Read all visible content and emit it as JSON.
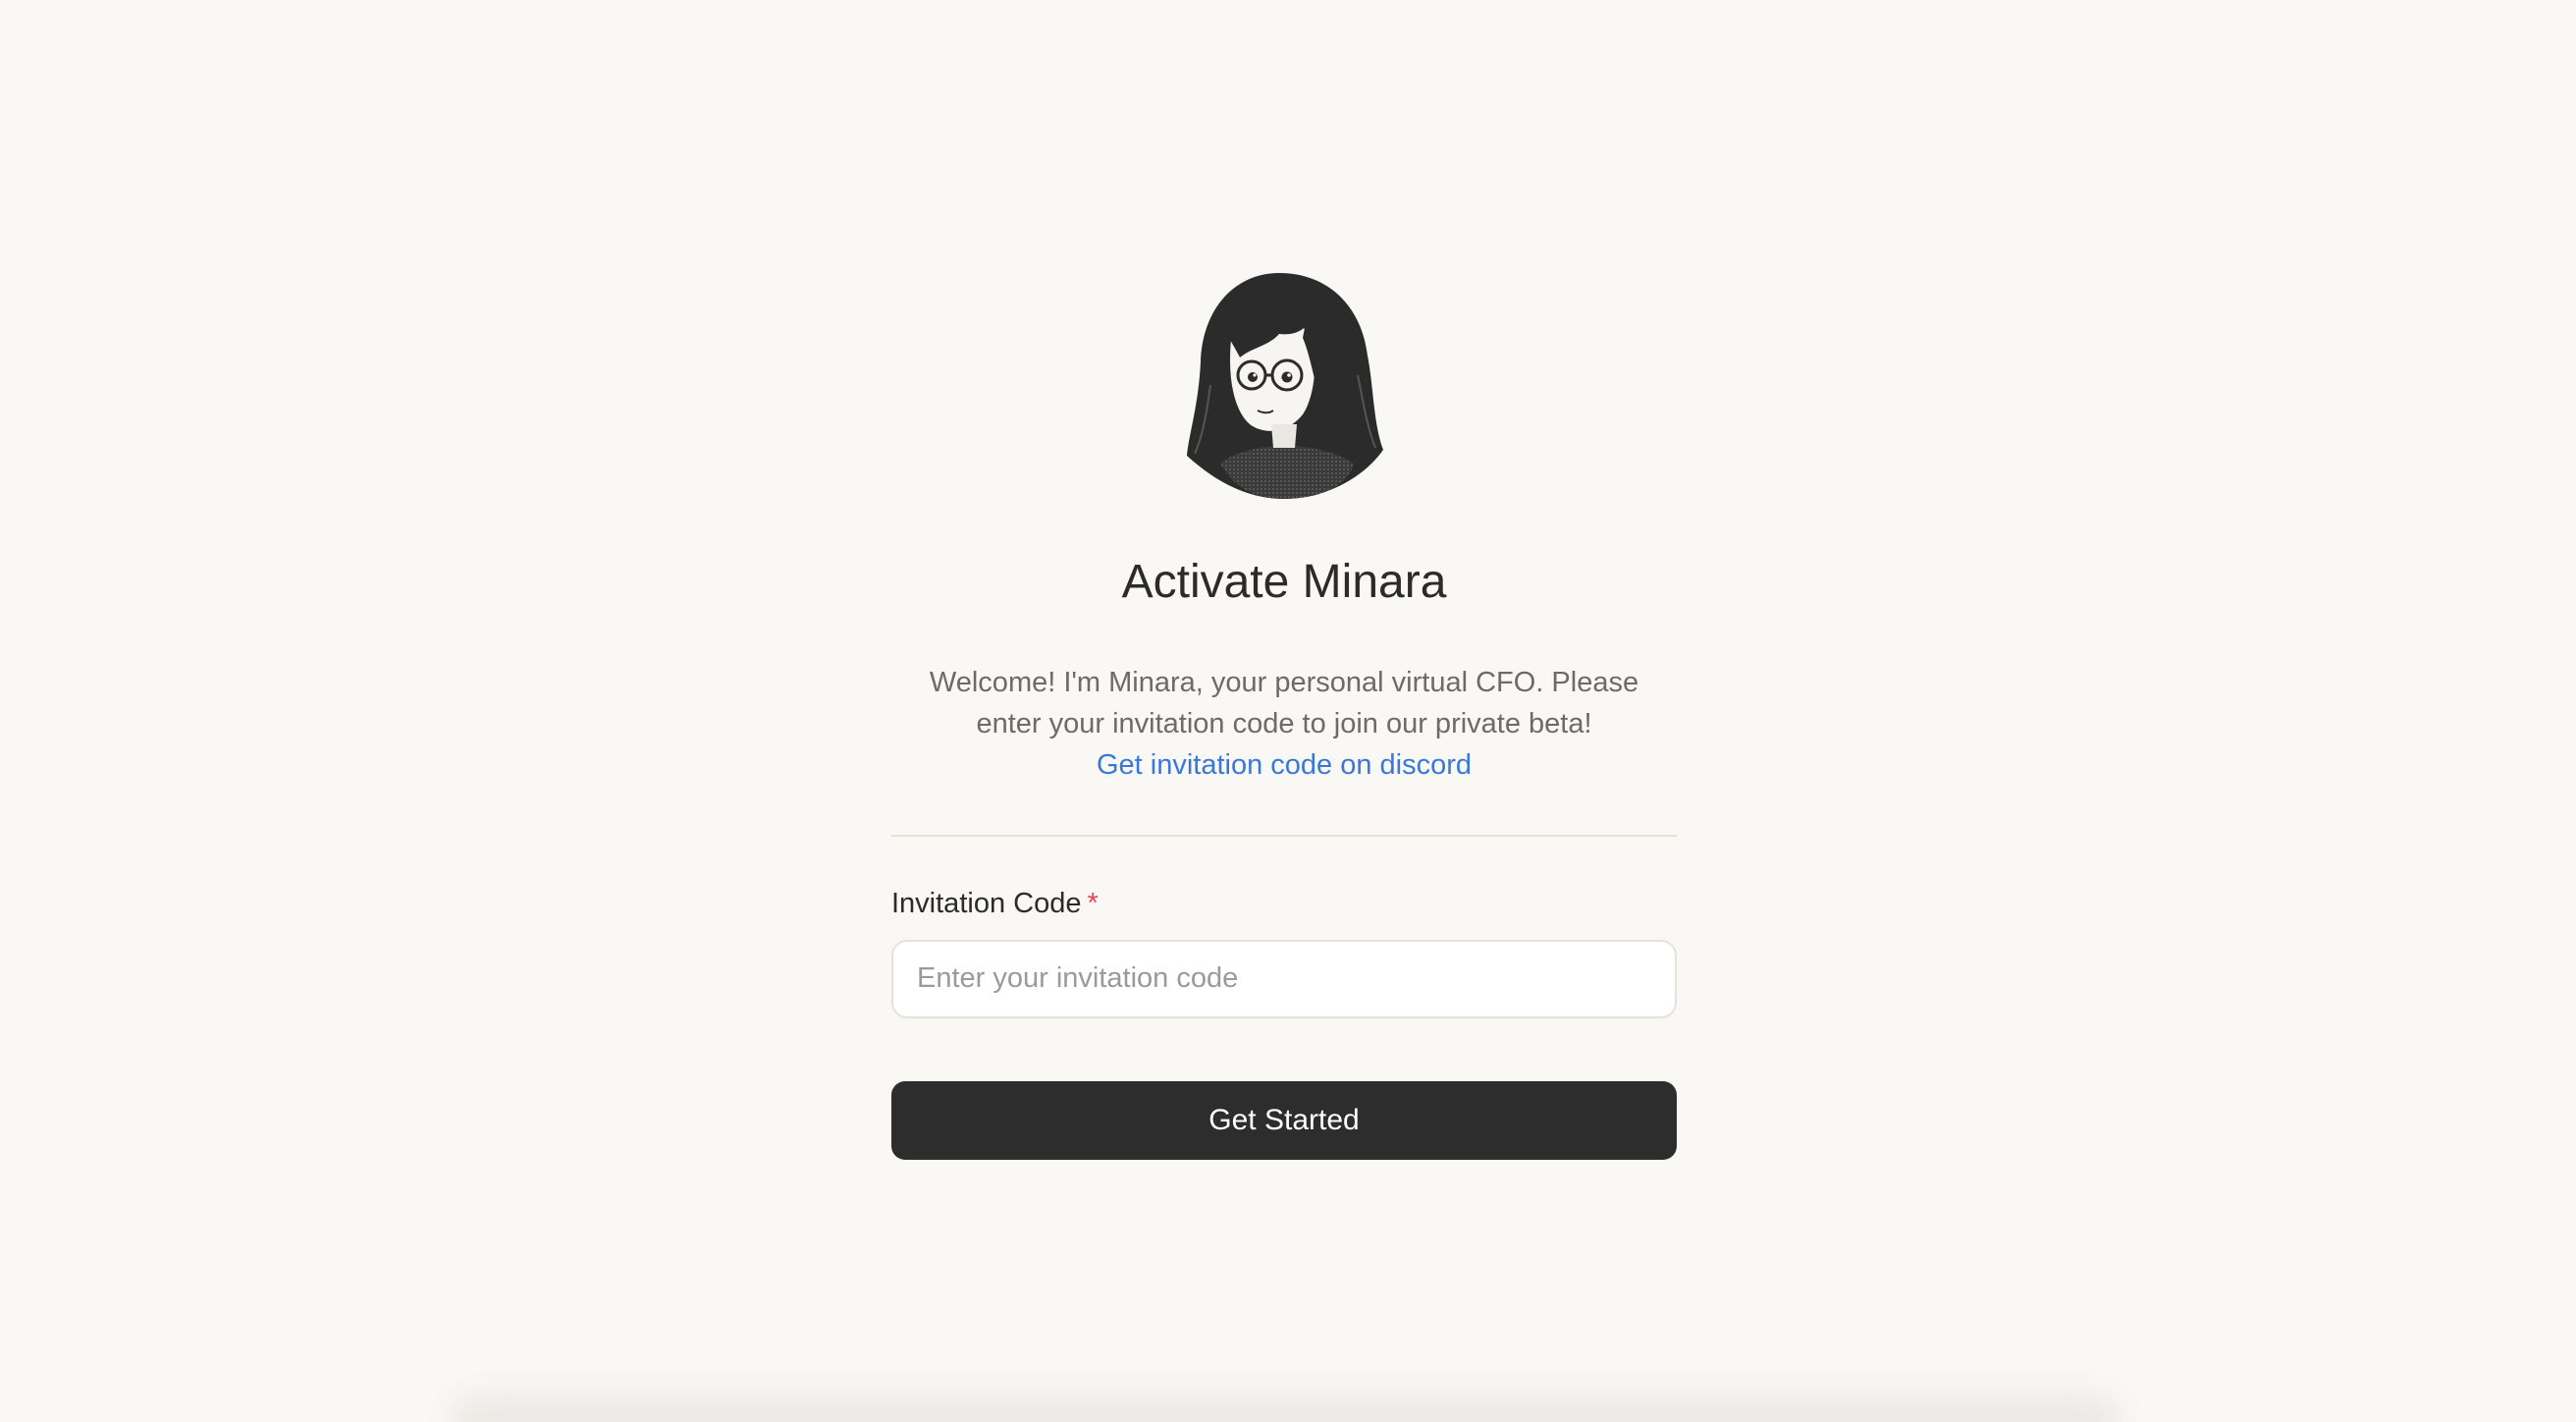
{
  "brand": {
    "title": "Activate Minara",
    "avatar_icon": "minara-portrait-icon"
  },
  "intro": {
    "text": "Welcome! I'm Minara, your personal virtual CFO. Please enter your invitation code to join our private beta!",
    "discord_link": "Get invitation code on discord"
  },
  "form": {
    "label": "Invitation Code",
    "required_mark": "*",
    "placeholder": "Enter your invitation code",
    "value": "",
    "submit_label": "Get Started"
  },
  "colors": {
    "background": "#f9f8f5",
    "link": "#3a78d8",
    "button": "#2d2d2d",
    "required": "#e5484d"
  }
}
